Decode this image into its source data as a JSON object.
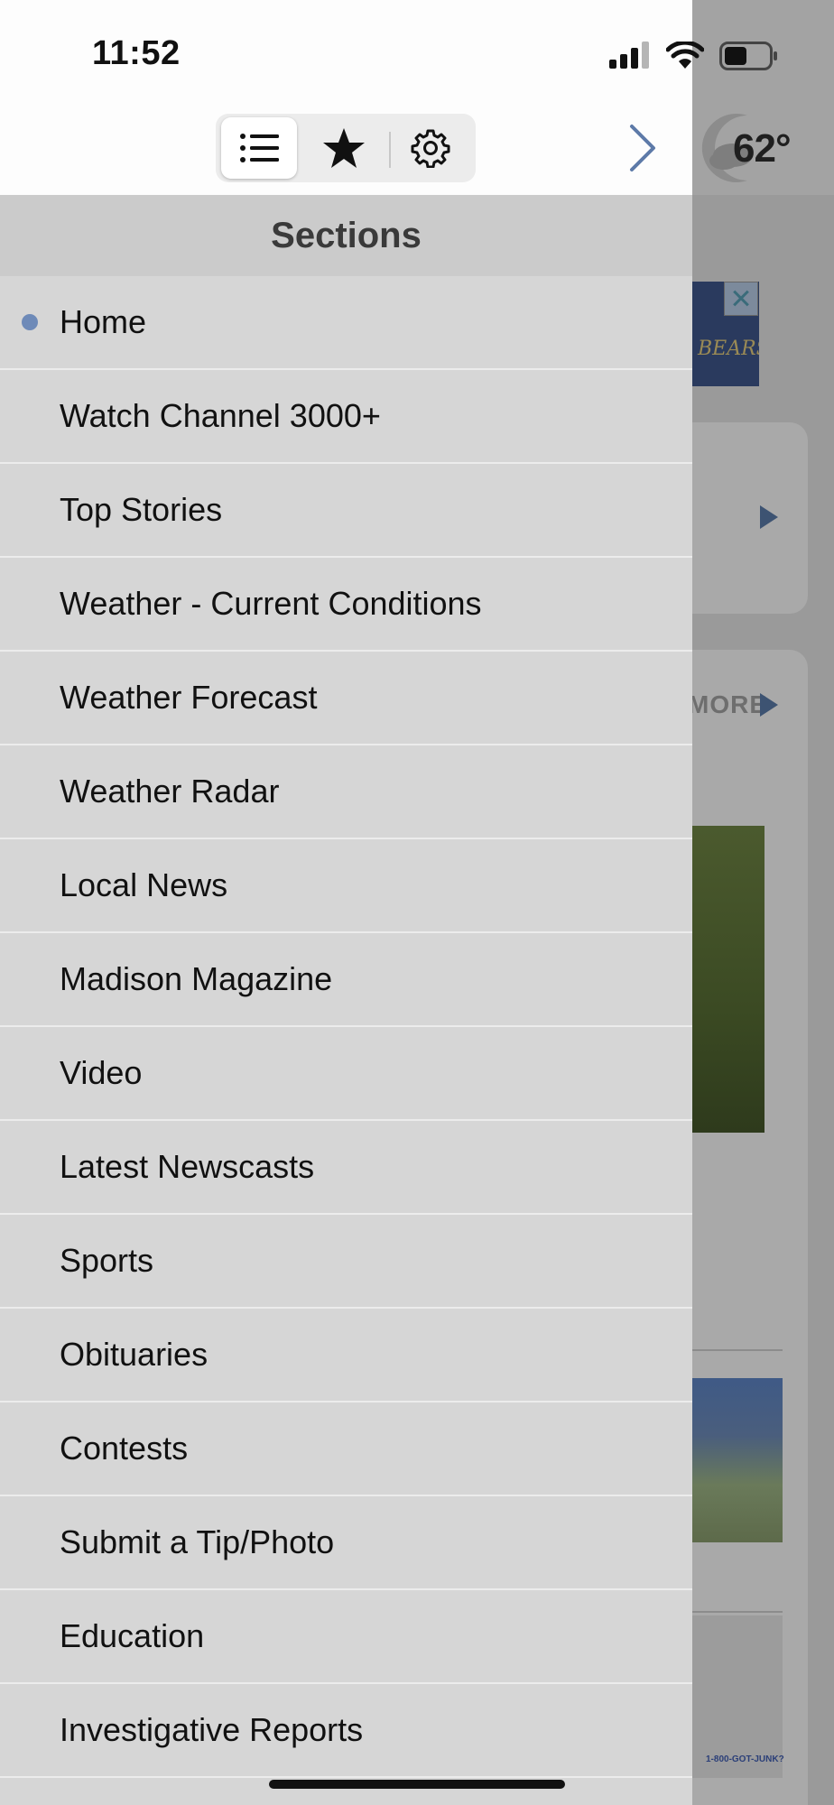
{
  "status_bar": {
    "time": "11:52"
  },
  "toolbar": {
    "segments": [
      "list-icon",
      "star-icon",
      "gear-icon"
    ],
    "selected_segment": "list-icon",
    "close_icon": "chevron-right-icon"
  },
  "sections": {
    "title": "Sections",
    "items": [
      {
        "label": "Home"
      },
      {
        "label": "Watch Channel 3000+"
      },
      {
        "label": "Top Stories"
      },
      {
        "label": "Weather - Current Conditions"
      },
      {
        "label": "Weather Forecast"
      },
      {
        "label": "Weather Radar"
      },
      {
        "label": "Local News"
      },
      {
        "label": "Madison Magazine"
      },
      {
        "label": "Video"
      },
      {
        "label": "Latest Newscasts"
      },
      {
        "label": "Sports"
      },
      {
        "label": "Obituaries"
      },
      {
        "label": "Contests"
      },
      {
        "label": "Submit a Tip/Photo"
      },
      {
        "label": "Education"
      },
      {
        "label": "Investigative Reports"
      }
    ],
    "active_index": 0
  },
  "background": {
    "temperature": "62°",
    "more_label": "MORE",
    "ad_text": "BEARS",
    "ad_phone": "1-800-GOT-JUNK?"
  },
  "colors": {
    "active_dot": "#6e8ab8",
    "chevron": "#5d7aa8",
    "drawer_bg": "#d6d6d6",
    "header_bg": "#cbcbcb"
  }
}
